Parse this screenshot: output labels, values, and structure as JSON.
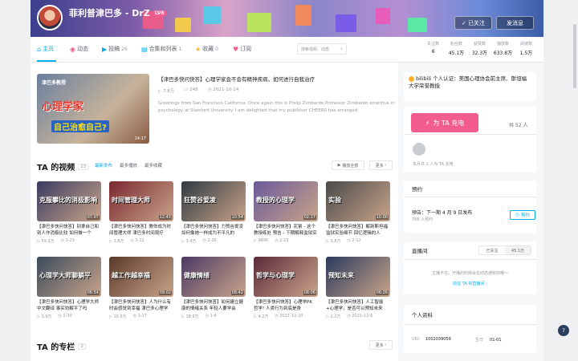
{
  "header": {
    "username": "菲利普津巴多 - DrZ",
    "level": "LV6",
    "followed_label": "已关注",
    "message_label": "发消息"
  },
  "nav": {
    "tabs": [
      {
        "label": "主页",
        "icon": "home-icon",
        "count": ""
      },
      {
        "label": "动态",
        "icon": "feed-icon",
        "count": ""
      },
      {
        "label": "投稿",
        "icon": "upload-icon",
        "count": "26"
      },
      {
        "label": "合集和列表",
        "icon": "collection-icon",
        "count": "1"
      },
      {
        "label": "收藏",
        "icon": "star-icon",
        "count": "0"
      },
      {
        "label": "订阅",
        "icon": "heart-icon",
        "count": ""
      }
    ],
    "search_placeholder": "搜索视频、动态"
  },
  "stats": [
    {
      "label": "关注数",
      "value": "6"
    },
    {
      "label": "粉丝数",
      "value": "45.1万"
    },
    {
      "label": "获赞数",
      "value": "32.3万"
    },
    {
      "label": "播放数",
      "value": "633.8万"
    },
    {
      "label": "阅读数",
      "value": "1.5万"
    }
  ],
  "top_video": {
    "thumb_line1": "津巴多教授",
    "thumb_line2": "心理学家",
    "thumb_line3": "自己治愈自己?",
    "duration": "14:17",
    "title": "【津巴多快问快答】心理学家会不会有精神疾病，如何进行自我治疗",
    "views": "7.8万",
    "comments": "248",
    "date": "2021-10-14",
    "desc": "Greetings from San Francisco California. Once again this is Philip Zimbardo,Professor Zimbardo emeritus in psychology at Stanford University. I am delighted that my publisher CHEERS has arranged"
  },
  "sidebar": {
    "cert_text": "bilibili 个人认证：美国心理协会前主席、斯坦福大学荣誉教授",
    "charge_label": "为 TA 充电",
    "charge_count": "共 52 人",
    "charge_note": "本月共 1 人为 TA 充电",
    "reserve_title": "预约",
    "reserve_text": "预告：下一期 4 月 9 日发布",
    "reserve_sub": "768 人预约",
    "reserve_btn": "预约",
    "live_title": "直播间",
    "live_followed": "已关注",
    "live_fans": "45.1万",
    "live_text": "主播不在，开播的时候会在动态通知你哦～",
    "live_link": "前往 TA 的直播间",
    "profile_title": "个人资料",
    "uid_label": "UID",
    "uid_value": "1002039059",
    "birthday_label": "生日",
    "birthday_value": "01-01"
  },
  "videos_section": {
    "title": "TA 的视频",
    "count": "23",
    "sort_tabs": [
      "最新发布",
      "最多播放",
      "最多收藏"
    ],
    "play_all": "播放全部",
    "more": "更多"
  },
  "videos": [
    {
      "cap": "克服攀比的消极影响",
      "dur": "07:07",
      "title": "【津巴多快问快答】别拿自己和别人作消极比较 如何做一个",
      "views": "59.3万",
      "date": "3-23",
      "color": "#3a3c62"
    },
    {
      "cap": "时间管理大师",
      "dur": "12:43",
      "title": "【津巴多快问快答】教你成为时间管理大师 津巴多时间观疗",
      "views": "3.8万",
      "date": "3-12",
      "color": "#7a2830"
    },
    {
      "cap": "狂赞谷爱凌",
      "dur": "10:54",
      "title": "【津巴多快问快答】力赞谷爱凌 如何像她一样成为不平凡的",
      "views": "3.4万",
      "date": "2-26",
      "color": "#2f3a42"
    },
    {
      "cap": "教授的心理学",
      "dur": "02:17",
      "title": "【津巴多快问快答】花絮 - 这个教授练处 预告 - 下期解释监狱实验",
      "views": "9896",
      "date": "2-23",
      "color": "#6a5a9a"
    },
    {
      "cap": "实验",
      "dur": "10:00",
      "title": "【津巴多快问快答】解剖斯坦福监狱实验细节 回忆逻辑的人",
      "views": "3.8万",
      "date": "2-12",
      "color": "#4a4a4a"
    },
    {
      "cap": "心理学大师聊躺平",
      "dur": "06:54",
      "title": "【津巴多快问快答】心理学大师中文翻译 事实劝解平了吗",
      "views": "3.9万",
      "date": "1-30",
      "color": "#3a4c5c"
    },
    {
      "cap": "越工作越幸福",
      "dur": "09:02",
      "title": "【津巴多快问快答】人为什么有时会感觉到幸福 津巴多心理学",
      "views": "10.9万",
      "date": "1-17",
      "color": "#5a3a2a"
    },
    {
      "cap": "健康情绪",
      "dur": "08:42",
      "title": "【津巴多快问快答】如何建立健康的情绪关系 年轻人要学会",
      "views": "18.9万",
      "date": "1-4",
      "color": "#4c3a64"
    },
    {
      "cap": "哲学与心理学",
      "dur": "08:06",
      "title": "【津巴多快问快答】心理学PK 哲学! 人类行为到底是身",
      "views": "4.2万",
      "date": "2021-12-20",
      "color": "#5c2a3a"
    },
    {
      "cap": "预知未来",
      "dur": "06:26",
      "title": "【津巴多快问快答】人工智能+心理学，是否可以预知未来",
      "views": "2.2万",
      "date": "2021-12-6",
      "color": "#2a3a5c"
    }
  ],
  "column_section": {
    "title": "TA 的专栏",
    "count": "3",
    "more": "更多"
  }
}
